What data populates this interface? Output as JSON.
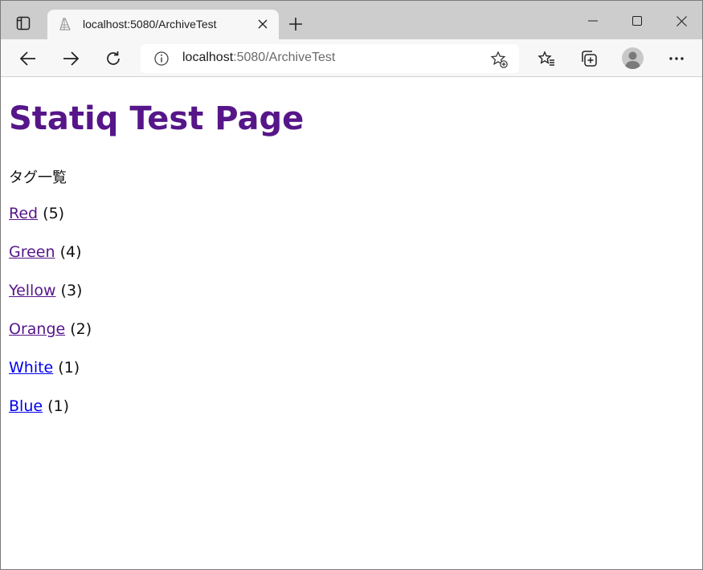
{
  "browser": {
    "tab_title": "localhost:5080/ArchiveTest",
    "url_host": "localhost",
    "url_rest": ":5080/ArchiveTest"
  },
  "page": {
    "heading": "Statiq Test Page",
    "subheading": "タグ一覧",
    "tags": [
      {
        "label": "Red",
        "count": "(5)"
      },
      {
        "label": "Green",
        "count": "(4)"
      },
      {
        "label": "Yellow",
        "count": "(3)"
      },
      {
        "label": "Orange",
        "count": "(2)"
      },
      {
        "label": "White",
        "count": "(1)"
      },
      {
        "label": "Blue",
        "count": "(1)"
      }
    ]
  },
  "colors": {
    "heading": "#561689",
    "visited_link": "#561689",
    "unvisited_link": "#0000ee",
    "tabstrip": "#cdcdcd",
    "toolbar": "#f7f7f7"
  },
  "icons": {
    "sidebar": "tab-actions-icon",
    "favicon": "page-favicon-icon",
    "close": "close-icon",
    "new_tab": "plus-icon",
    "minimize": "minimize-icon",
    "maximize": "maximize-icon",
    "window_close": "window-close-icon",
    "back": "back-arrow-icon",
    "forward": "forward-arrow-icon",
    "refresh": "refresh-icon",
    "info": "info-icon",
    "add_favorite": "add-favorite-icon",
    "favorites": "favorites-icon",
    "collections": "collections-icon",
    "profile": "profile-icon",
    "more": "more-icon"
  }
}
